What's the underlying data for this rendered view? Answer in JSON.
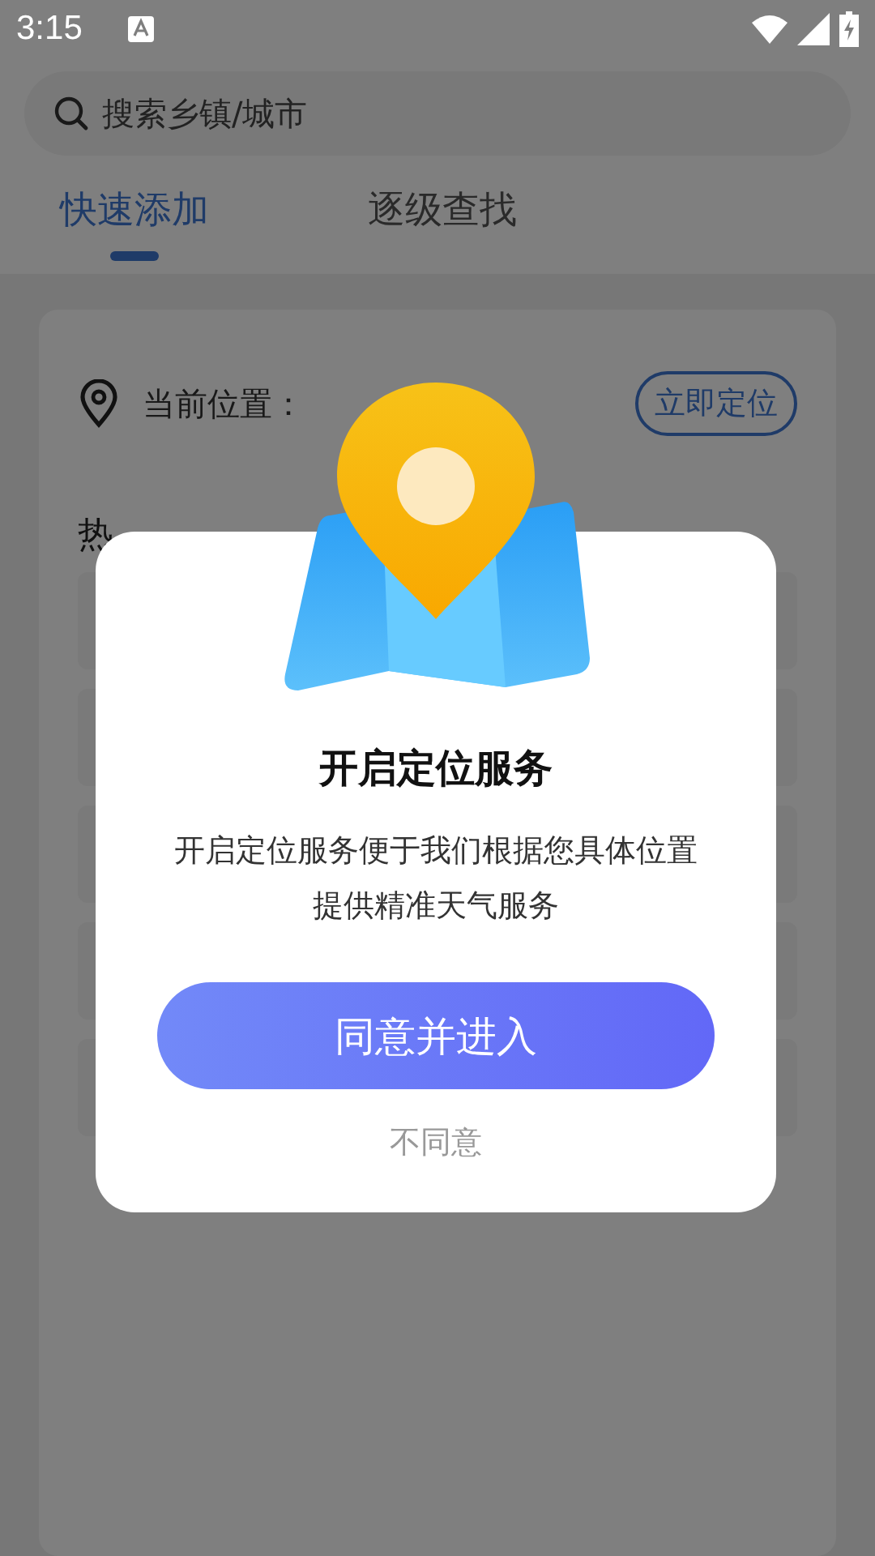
{
  "status_bar": {
    "time": "3:15"
  },
  "search": {
    "placeholder": "搜索乡镇/城市"
  },
  "tabs": [
    {
      "label": "快速添加",
      "selected": true
    },
    {
      "label": "逐级查找",
      "selected": false
    }
  ],
  "location": {
    "label": "当前位置：",
    "button": "立即定位"
  },
  "hot_cities": {
    "title": "热"
  },
  "dialog": {
    "title": "开启定位服务",
    "message": "开启定位服务便于我们根据您具体位置提供精准天气服务",
    "confirm": "同意并进入",
    "cancel": "不同意"
  }
}
